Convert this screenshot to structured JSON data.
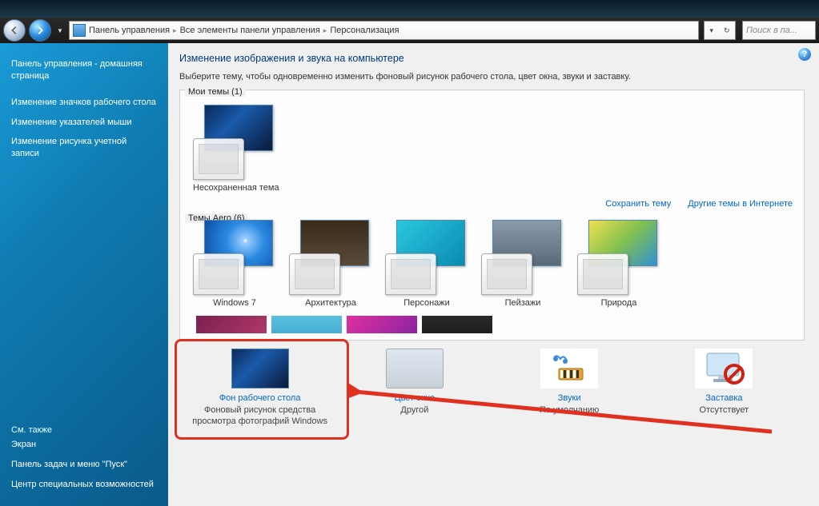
{
  "breadcrumb": {
    "level1": "Панель управления",
    "level2": "Все элементы панели управления",
    "level3": "Персонализация"
  },
  "search": {
    "placeholder": "Поиск в па..."
  },
  "sidebar": {
    "home": "Панель управления - домашняя страница",
    "links": [
      "Изменение значков рабочего стола",
      "Изменение указателей мыши",
      "Изменение рисунка учетной записи"
    ],
    "see_also_header": "См. также",
    "see_also": [
      "Экран",
      "Панель задач и меню \"Пуск\"",
      "Центр специальных возможностей"
    ]
  },
  "page": {
    "title": "Изменение изображения и звука на компьютере",
    "desc": "Выберите тему, чтобы одновременно изменить фоновый рисунок рабочего стола, цвет окна, звуки и заставку."
  },
  "groups": {
    "my_themes_label": "Мои темы (1)",
    "my_themes": [
      {
        "name": "Несохраненная тема"
      }
    ],
    "save_theme": "Сохранить тему",
    "more_online": "Другие темы в Интернете",
    "aero_label": "Темы Aero (6)",
    "aero": [
      {
        "name": "Windows 7",
        "cls": "w7"
      },
      {
        "name": "Архитектура",
        "cls": "arch"
      },
      {
        "name": "Персонажи",
        "cls": "char"
      },
      {
        "name": "Пейзажи",
        "cls": "land"
      },
      {
        "name": "Природа",
        "cls": "nat"
      }
    ]
  },
  "bottom": {
    "wallpaper": {
      "title": "Фон рабочего стола",
      "sub": "Фоновый рисунок средства просмотра фотографий Windows"
    },
    "color": {
      "title": "Цвет окна",
      "sub": "Другой"
    },
    "sound": {
      "title": "Звуки",
      "sub": "По умолчанию"
    },
    "saver": {
      "title": "Заставка",
      "sub": "Отсутствует"
    }
  }
}
